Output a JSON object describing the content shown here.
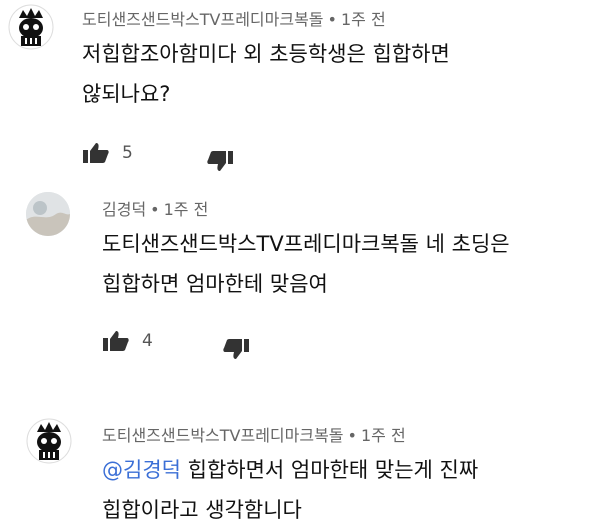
{
  "comments": [
    {
      "author": "도티샌즈샌드박스TV프레디마크복돌",
      "time": "1주 전",
      "text_lines": [
        "저힙합조아함미다 외 초등학생은 힙합하면",
        "않되나요?"
      ],
      "likes": "5",
      "avatar_icon": "skull-king-avatar-icon"
    },
    {
      "author": "김경덕",
      "time": "1주 전",
      "text_lines": [
        "도티샌즈샌드박스TV프레디마크복돌 네 초딩은",
        "힙합하면 엄마한테 맞음여"
      ],
      "likes": "4",
      "avatar_icon": "photo-avatar-icon"
    },
    {
      "author": "도티샌즈샌드박스TV프레디마크복돌",
      "time": "1주 전",
      "mention": "@김경덕",
      "text_lines": [
        "힙합하면서 엄마한태 맞는게 진짜",
        "힙합이라고 생각함니다"
      ],
      "avatar_icon": "skull-king-avatar-icon"
    }
  ],
  "separator": "•",
  "colors": {
    "mention": "#3b6fd6",
    "meta": "#666666",
    "text": "#111111"
  }
}
